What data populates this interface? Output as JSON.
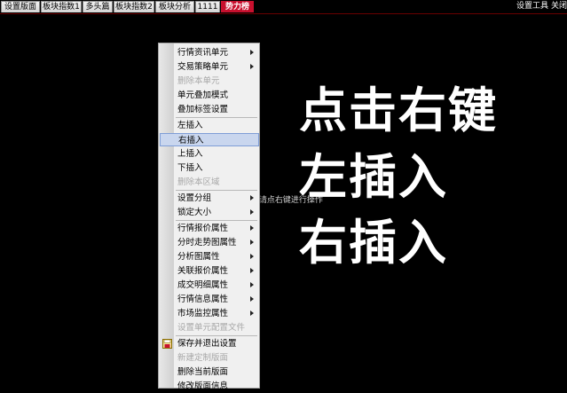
{
  "tabs": [
    {
      "label": "设置版面",
      "active": false
    },
    {
      "label": "板块指数1",
      "active": false
    },
    {
      "label": "多头篇",
      "active": false
    },
    {
      "label": "板块指数2",
      "active": false
    },
    {
      "label": "板块分析",
      "active": false
    },
    {
      "label": "1111",
      "active": false
    },
    {
      "label": "势力榜",
      "active": true
    }
  ],
  "toolbar": {
    "settings_tools": "设置工具",
    "close": "关闭"
  },
  "background_message": "元 请点右键进行操作",
  "menu": {
    "items": [
      {
        "label": "行情资讯单元",
        "submenu": true,
        "disabled": false
      },
      {
        "label": "交易策略单元",
        "submenu": true,
        "disabled": false
      },
      {
        "label": "删除本单元",
        "submenu": false,
        "disabled": true
      },
      {
        "label": "单元叠加模式",
        "submenu": false,
        "disabled": false
      },
      {
        "label": "叠加标签设置",
        "submenu": false,
        "disabled": false
      },
      {
        "label": "左插入",
        "submenu": false,
        "disabled": false
      },
      {
        "label": "右插入",
        "submenu": false,
        "disabled": false,
        "highlighted": true
      },
      {
        "label": "上插入",
        "submenu": false,
        "disabled": false
      },
      {
        "label": "下插入",
        "submenu": false,
        "disabled": false
      },
      {
        "label": "删除本区域",
        "submenu": false,
        "disabled": true
      },
      {
        "label": "设置分组",
        "submenu": true,
        "disabled": false
      },
      {
        "label": "锁定大小",
        "submenu": true,
        "disabled": false
      },
      {
        "label": "行情报价属性",
        "submenu": true,
        "disabled": false
      },
      {
        "label": "分时走势图属性",
        "submenu": true,
        "disabled": false
      },
      {
        "label": "分析图属性",
        "submenu": true,
        "disabled": false
      },
      {
        "label": "关联报价属性",
        "submenu": true,
        "disabled": false
      },
      {
        "label": "成交明细属性",
        "submenu": true,
        "disabled": false
      },
      {
        "label": "行情信息属性",
        "submenu": true,
        "disabled": false
      },
      {
        "label": "市场监控属性",
        "submenu": true,
        "disabled": false
      },
      {
        "label": "设置单元配置文件",
        "submenu": false,
        "disabled": true
      },
      {
        "label": "保存并退出设置",
        "submenu": false,
        "disabled": false,
        "icon": "save-exit-icon"
      },
      {
        "label": "新建定制版面",
        "submenu": false,
        "disabled": true
      },
      {
        "label": "删除当前版面",
        "submenu": false,
        "disabled": false
      },
      {
        "label": "修改版面信息",
        "submenu": false,
        "disabled": false
      }
    ]
  },
  "overlay": {
    "line1": "点击右键",
    "line2": "左插入",
    "line3": "右插入"
  },
  "colors": {
    "active_tab": "#c8102e",
    "highlight": "#c9d6ee",
    "background": "#000000"
  }
}
